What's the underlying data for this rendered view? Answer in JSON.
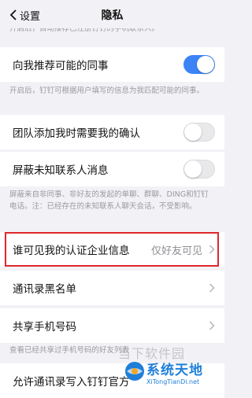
{
  "nav": {
    "back_label": "设置",
    "title": "隐私"
  },
  "top_hint": "开启后，自动推荐已注册钉钉的手机联系人。",
  "recommend": {
    "label": "向我推荐可能的同事",
    "on": true,
    "hint": "开启后，钉钉可根据用户填写的信息为我匹配可能的同事。"
  },
  "team_confirm": {
    "label": "团队添加我时需要我的确认",
    "on": false
  },
  "block_unknown": {
    "label": "屏蔽未知联系人消息",
    "on": false,
    "hint": "屏蔽来自非同事、非好友的发起的单聊、群聊、DING和钉钉电话。注：已经存在的未知联系人聊天会话，不受影响。"
  },
  "cert_visibility": {
    "label": "谁可见我的认证企业信息",
    "value": "仅好友可见"
  },
  "blacklist": {
    "label": "通讯录黑名单"
  },
  "share_phone": {
    "label": "共享手机号码",
    "hint": "查看已经共享过手机号码的好友列表"
  },
  "allow_write": {
    "label": "允许通讯录写入钉钉官方"
  },
  "watermark": {
    "site_text": "当下软件园",
    "brand_cn": "系统天地",
    "brand_en": "XiTongTianDi.net"
  },
  "colors": {
    "toggle_on": "#3c84f6",
    "highlight": "#e0262b"
  }
}
